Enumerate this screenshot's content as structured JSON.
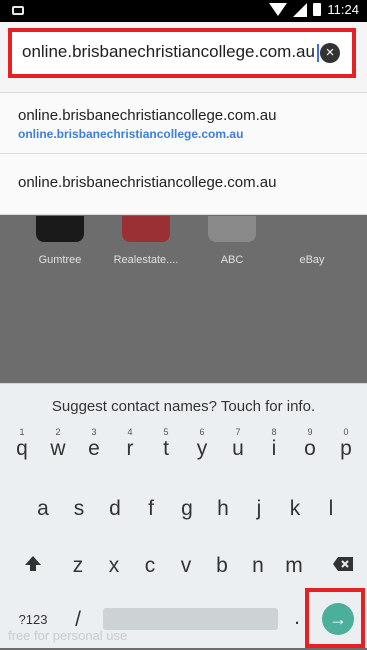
{
  "status_bar": {
    "time": "11:24"
  },
  "url_bar": {
    "value": "online.brisbanechristiancollege.com.au",
    "clear_icon": "close-icon"
  },
  "suggestions": [
    {
      "title": "online.brisbanechristiancollege.com.au",
      "subtitle": "online.brisbanechristiancollege.com.au"
    },
    {
      "title": "online.brisbanechristiancollege.com.au"
    }
  ],
  "tiles": [
    {
      "label": "Gumtree",
      "color": "#1a1a1a"
    },
    {
      "label": "Realestate....",
      "color": "#d6202a"
    },
    {
      "label": "ABC",
      "color": "#7f7f7f"
    },
    {
      "label": "eBay",
      "color": "#6d6d6d"
    }
  ],
  "keyboard": {
    "suggestion_text": "Suggest contact names? Touch for info.",
    "row1": [
      "q",
      "w",
      "e",
      "r",
      "t",
      "y",
      "u",
      "i",
      "o",
      "p"
    ],
    "row1_hints": [
      "1",
      "2",
      "3",
      "4",
      "5",
      "6",
      "7",
      "8",
      "9",
      "0"
    ],
    "row2": [
      "a",
      "s",
      "d",
      "f",
      "g",
      "h",
      "j",
      "k",
      "l"
    ],
    "row3": [
      "z",
      "x",
      "c",
      "v",
      "b",
      "n",
      "m"
    ],
    "symbols_key": "?123",
    "slash_key": "/",
    "period_key": ".",
    "go_icon": "arrow-right-icon",
    "shift_icon": "shift-icon",
    "backspace_icon": "backspace-icon"
  },
  "watermark": "free for personal use"
}
